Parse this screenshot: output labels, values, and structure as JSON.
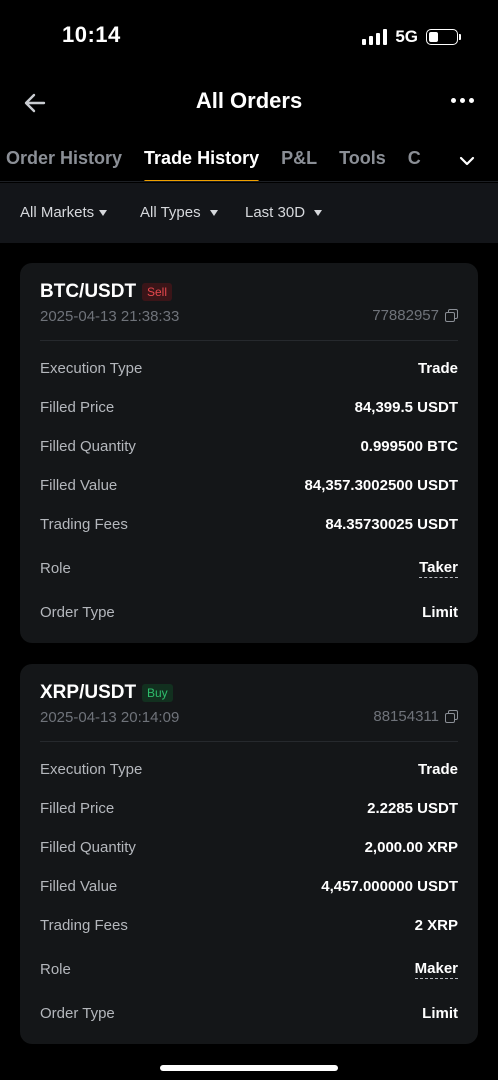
{
  "status_bar": {
    "time": "10:14",
    "network": "5G"
  },
  "header": {
    "title": "All Orders"
  },
  "tabs": [
    {
      "label": "Order History",
      "active": false
    },
    {
      "label": "Trade History",
      "active": true
    },
    {
      "label": "P&L",
      "active": false
    },
    {
      "label": "Tools",
      "active": false
    },
    {
      "label": "C",
      "active": false
    }
  ],
  "filters": {
    "markets": "All Markets",
    "types": "All Types",
    "period": "Last 30D"
  },
  "trades": [
    {
      "pair": "BTC/USDT",
      "side": "Sell",
      "time": "2025-04-13 21:38:33",
      "id": "77882957",
      "rows": [
        {
          "label": "Execution Type",
          "value": "Trade"
        },
        {
          "label": "Filled Price",
          "value": "84,399.5 USDT"
        },
        {
          "label": "Filled Quantity",
          "value": "0.999500 BTC"
        },
        {
          "label": "Filled Value",
          "value": "84,357.3002500 USDT"
        },
        {
          "label": "Trading Fees",
          "value": "84.35730025 USDT"
        },
        {
          "label": "Role",
          "value": "Taker"
        },
        {
          "label": "Order Type",
          "value": "Limit"
        }
      ]
    },
    {
      "pair": "XRP/USDT",
      "side": "Buy",
      "time": "2025-04-13 20:14:09",
      "id": "88154311",
      "rows": [
        {
          "label": "Execution Type",
          "value": "Trade"
        },
        {
          "label": "Filled Price",
          "value": "2.2285 USDT"
        },
        {
          "label": "Filled Quantity",
          "value": "2,000.00 XRP"
        },
        {
          "label": "Filled Value",
          "value": "4,457.000000 USDT"
        },
        {
          "label": "Trading Fees",
          "value": "2 XRP"
        },
        {
          "label": "Role",
          "value": "Maker"
        },
        {
          "label": "Order Type",
          "value": "Limit"
        }
      ]
    }
  ],
  "colors": {
    "accent": "#f0a000",
    "sell": "#e5484d",
    "buy": "#2ebd6b",
    "card": "#141618"
  }
}
